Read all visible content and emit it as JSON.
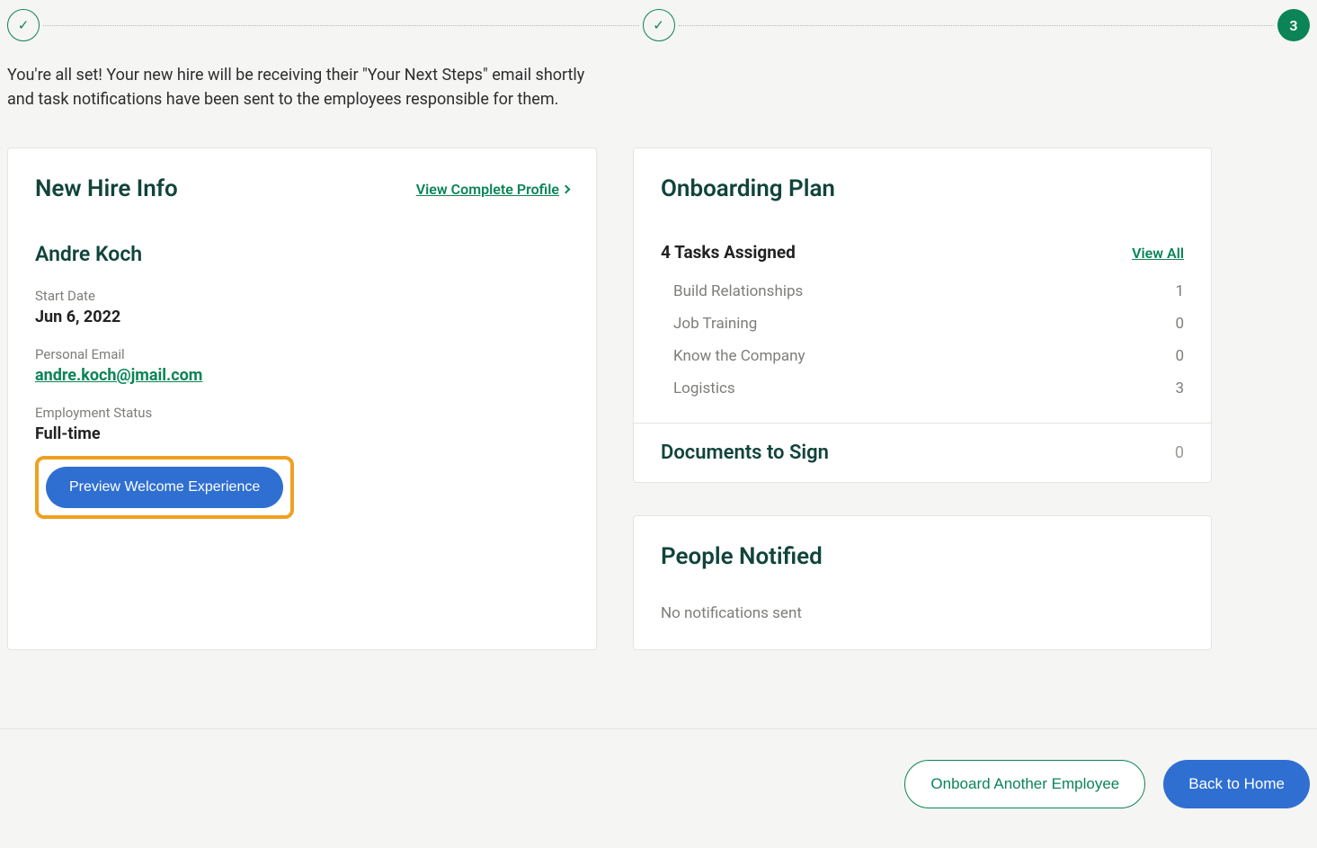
{
  "stepper": {
    "steps": [
      {
        "kind": "done",
        "label": "✓"
      },
      {
        "kind": "done",
        "label": "✓"
      },
      {
        "kind": "active",
        "label": "3"
      }
    ]
  },
  "intro": "You're all set! Your new hire will be receiving their \"Your Next Steps\" email shortly and task notifications have been sent to the employees responsible for them.",
  "newHire": {
    "title": "New Hire Info",
    "viewProfile": "View Complete Profile",
    "name": "Andre Koch",
    "startDateLabel": "Start Date",
    "startDate": "Jun 6, 2022",
    "emailLabel": "Personal Email",
    "email": "andre.koch@jmail.com",
    "statusLabel": "Employment Status",
    "status": "Full-time",
    "previewBtn": "Preview Welcome Experience"
  },
  "plan": {
    "title": "Onboarding Plan",
    "assignedLabel": "4 Tasks Assigned",
    "viewAll": "View All",
    "tasks": [
      {
        "name": "Build Relationships",
        "count": "1"
      },
      {
        "name": "Job Training",
        "count": "0"
      },
      {
        "name": "Know the Company",
        "count": "0"
      },
      {
        "name": "Logistics",
        "count": "3"
      }
    ],
    "docsTitle": "Documents to Sign",
    "docsCount": "0"
  },
  "notified": {
    "title": "People Notified",
    "empty": "No notifications sent"
  },
  "footer": {
    "onboardAnother": "Onboard Another Employee",
    "backHome": "Back to Home"
  }
}
